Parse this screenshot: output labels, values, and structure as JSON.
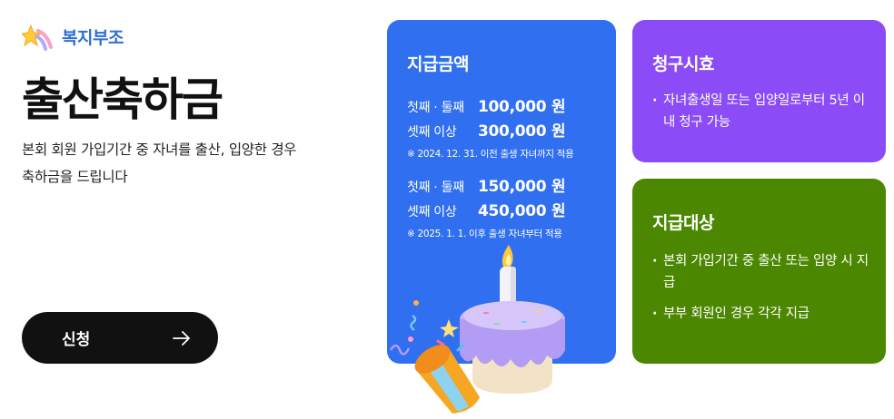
{
  "brand": {
    "label": "복지부조",
    "icon": "sparkle-star-icon"
  },
  "title": "출산축하금",
  "description": "본회 회원 가입기간 중 자녀를 출산, 입양한 경우 축하금을 드립니다",
  "apply_button": {
    "label": "신청",
    "icon": "arrow-right-icon"
  },
  "amount_card": {
    "title": "지급금액",
    "color": "#2f6ff0",
    "before": {
      "rows": [
        {
          "label": "첫째 · 둘째",
          "value": "100,000 원"
        },
        {
          "label": "셋째 이상",
          "value": "300,000 원"
        }
      ],
      "note": "※ 2024. 12. 31. 이전 출생 자녀까지 적용"
    },
    "after": {
      "rows": [
        {
          "label": "첫째 · 둘째",
          "value": "150,000 원"
        },
        {
          "label": "셋째 이상",
          "value": "450,000 원"
        }
      ],
      "note": "※ 2025. 1. 1. 이후 출생 자녀부터 적용"
    }
  },
  "claim_card": {
    "title": "청구시효",
    "color": "#8b4cf7",
    "items": [
      "자녀출생일 또는 입양일로부터 5년 이내 청구 가능"
    ]
  },
  "target_card": {
    "title": "지급대상",
    "color": "#4c8702",
    "items": [
      "본회 가입기간 중 출산 또는 입양 시 지급",
      "부부 회원인 경우 각각 지급"
    ]
  },
  "illustration": {
    "icon": "birthday-cake-party-popper-icon"
  }
}
